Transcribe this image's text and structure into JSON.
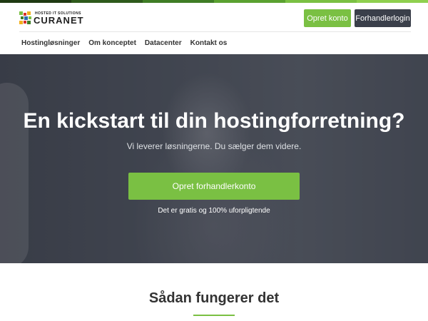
{
  "colors": {
    "accent_green": "#7ac043",
    "dark_button": "#3a3f4a",
    "top_strip": [
      "#1f3a12",
      "#2e5a1c",
      "#3f7d26",
      "#5aa130",
      "#7ac043",
      "#8fd04f"
    ]
  },
  "logo": {
    "tagline": "HOSTED IT SOLUTIONS",
    "name": "CURANET",
    "icon": "curanet-logo-mark"
  },
  "header": {
    "signup_button": "Opret konto",
    "reseller_login_button": "Forhandlerlogin"
  },
  "nav": {
    "items": [
      {
        "label": "Hostingløsninger"
      },
      {
        "label": "Om konceptet"
      },
      {
        "label": "Datacenter"
      },
      {
        "label": "Kontakt os"
      }
    ]
  },
  "hero": {
    "title": "En kickstart til din hostingforretning?",
    "subtitle": "Vi leverer løsningerne. Du sælger dem videre.",
    "cta_button": "Opret forhandlerkonto",
    "note": "Det er gratis og 100% uforpligtende"
  },
  "how": {
    "title": "Sådan fungerer det"
  }
}
